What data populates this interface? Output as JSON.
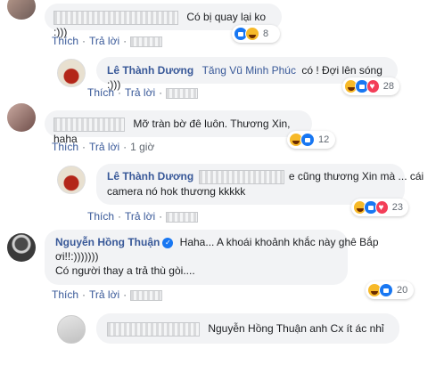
{
  "actions": {
    "like": "Thích",
    "reply": "Trả lời"
  },
  "comments": [
    {
      "text": "Có bị quay lại ko :)))",
      "reactions": "8"
    },
    {
      "name": "Lê Thành Dương",
      "mention": "Tăng Vũ Minh Phúc",
      "text": "có ! Đợi lên sóng :)))",
      "reactions": "28"
    },
    {
      "text": "Mỡ tràn bờ đê luôn. Thương Xin, haha",
      "time": "1 giờ",
      "reactions": "12"
    },
    {
      "name": "Lê Thành Dương",
      "text": "e cũng thương Xin mà ... cái",
      "text2": "camera nó hok thương kkkkk",
      "reactions": "23"
    },
    {
      "name": "Nguyễn Hồng Thuận",
      "text": "Haha... A khoái khoảnh khắc này ghê Bắp",
      "text2": "ơi!!:)))))))",
      "text3": "Có người thay a trả thù gòi....",
      "reactions": "20"
    },
    {
      "text": "Nguyễn Hồng Thuận anh Cx ít ác nhỉ"
    }
  ],
  "colors": {
    "link": "#385898",
    "bubble": "#f2f3f5",
    "like": "#1877f2",
    "haha": "#f7b928",
    "love": "#f33e58"
  }
}
